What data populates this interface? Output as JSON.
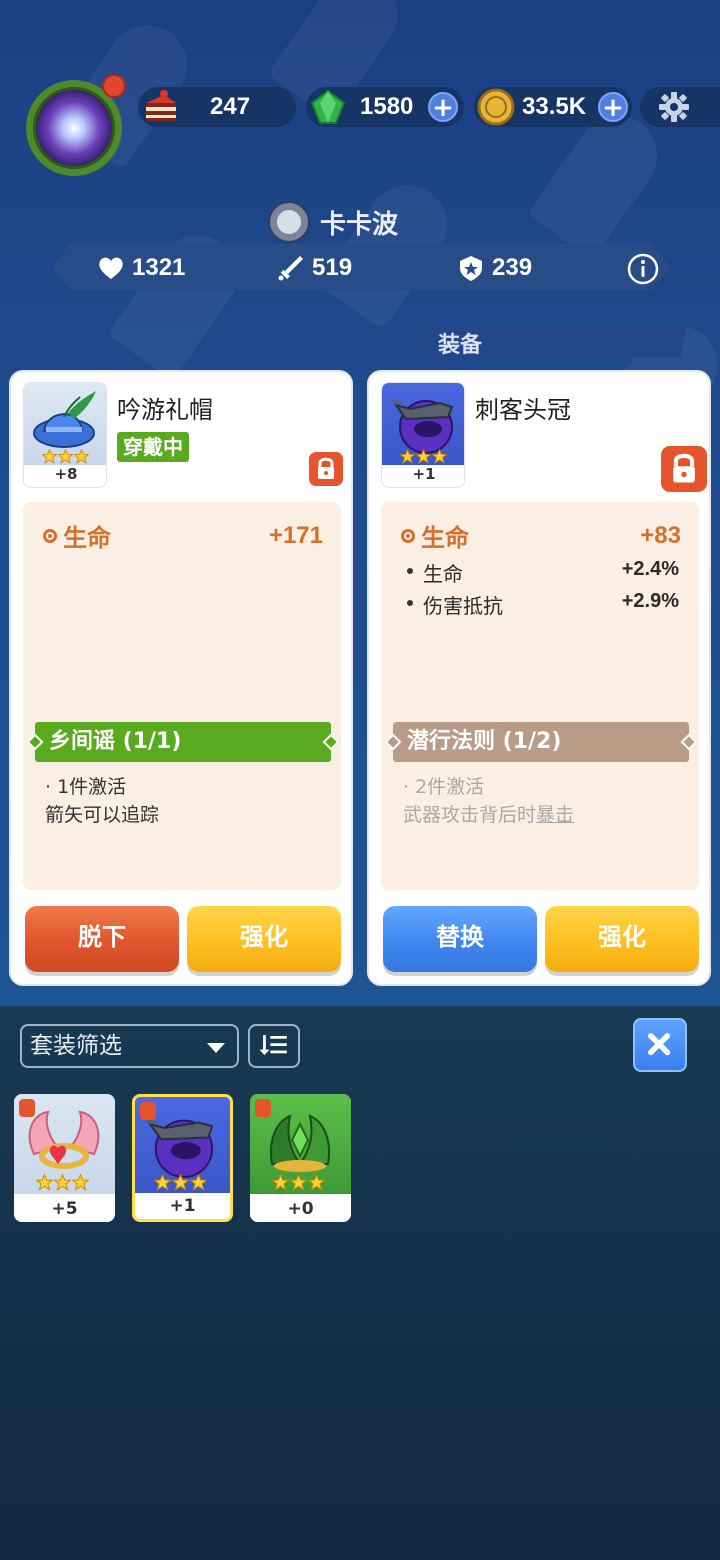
{
  "resources": {
    "cake": {
      "value": "247",
      "icon": "cake-icon"
    },
    "gems": {
      "value": "1580",
      "icon": "gem-icon"
    },
    "coins": {
      "value": "33.5K",
      "icon": "coin-icon"
    }
  },
  "player": {
    "name": "卡卡波",
    "stats": {
      "hp": "1321",
      "attack": "519",
      "defense": "239"
    }
  },
  "section_label": "装备",
  "equipped_card": {
    "name": "吟游礼帽",
    "badge": "穿戴中",
    "level": "+8",
    "stars": 3,
    "main_stat": {
      "label": "生命",
      "value": "+171"
    },
    "sub_stats": [],
    "set_name": "乡间谣 (1/1)",
    "set_piece_line": "· 1件激活",
    "set_effect": "箭矢可以追踪",
    "buttons": {
      "primary": "脱下",
      "secondary": "强化"
    }
  },
  "compare_card": {
    "name": "刺客头冠",
    "level": "+1",
    "stars": 3,
    "main_stat": {
      "label": "生命",
      "value": "+83"
    },
    "sub_stats": [
      {
        "label": "生命",
        "value": "+2.4%"
      },
      {
        "label": "伤害抵抗",
        "value": "+2.9%"
      }
    ],
    "set_name": "潜行法则 (1/2)",
    "set_piece_line": "· 2件激活",
    "set_effect_prefix": "武器攻击背后时",
    "set_effect_link": "暴击",
    "buttons": {
      "primary": "替换",
      "secondary": "强化"
    }
  },
  "filter": {
    "label": "套装筛选"
  },
  "inventory": [
    {
      "name": "wing-ring",
      "level": "+5",
      "stars": 3,
      "selected": false
    },
    {
      "name": "assassin-helm",
      "level": "+1",
      "stars": 3,
      "selected": true
    },
    {
      "name": "leaf-crown",
      "level": "+0",
      "stars": 3,
      "selected": false
    }
  ],
  "colors": {
    "accent_orange": "#d4702c",
    "set_active_green": "#5aaa20",
    "set_inactive_brown": "#b89c88",
    "button_red": "#e0552c",
    "button_yellow": "#ffbf20",
    "button_blue": "#3f86f0"
  }
}
